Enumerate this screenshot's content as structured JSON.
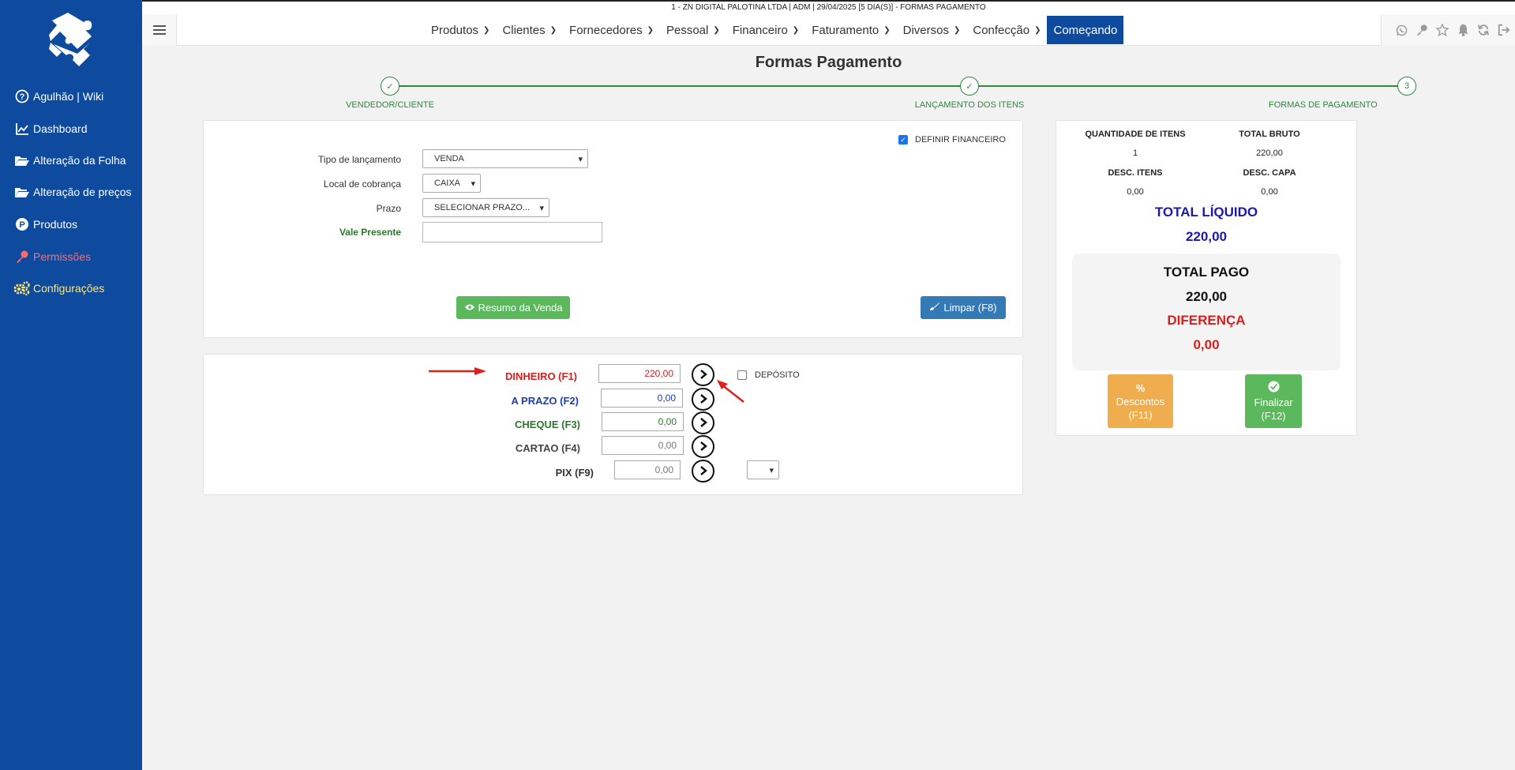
{
  "window": {
    "top_info": "1 - ZN DIGITAL PALOTINA LTDA    | ADM | 29/04/2025 [5 DIA(S)] - FORMAS PAGAMENTO"
  },
  "sidebar": {
    "items": [
      {
        "label": "Agulhão | Wiki",
        "icon": "help-circle-icon",
        "color": "#ffffff"
      },
      {
        "label": "Dashboard",
        "icon": "chart-line-icon",
        "color": "#ffffff"
      },
      {
        "label": "Alteração da Folha",
        "icon": "folder-open-icon",
        "color": "#ffffff"
      },
      {
        "label": "Alteração de preços",
        "icon": "folder-open-icon",
        "color": "#ffffff"
      },
      {
        "label": "Produtos",
        "icon": "p-circle-icon",
        "color": "#ffffff"
      },
      {
        "label": "Permissões",
        "icon": "key-icon",
        "color": "#ff6b6b"
      },
      {
        "label": "Configurações",
        "icon": "gears-icon",
        "color": "#ffe66d"
      }
    ]
  },
  "nav": {
    "items": [
      {
        "label": "Produtos"
      },
      {
        "label": "Clientes"
      },
      {
        "label": "Fornecedores"
      },
      {
        "label": "Pessoal"
      },
      {
        "label": "Financeiro"
      },
      {
        "label": "Faturamento"
      },
      {
        "label": "Diversos"
      },
      {
        "label": "Confecção"
      }
    ],
    "active_label": "Começando",
    "right_icons": [
      "whatsapp-icon",
      "key-icon",
      "star-icon",
      "bell-icon",
      "refresh-icon",
      "logout-icon"
    ]
  },
  "page": {
    "title": "Formas Pagamento"
  },
  "stepper": {
    "steps": [
      {
        "label": "VENDEDOR/CLIENTE",
        "mark": "✓"
      },
      {
        "label": "LANÇAMENTO DOS ITENS",
        "mark": "✓"
      },
      {
        "label": "FORMAS DE PAGAMENTO",
        "mark": "3"
      }
    ]
  },
  "form": {
    "definir_financeiro": {
      "label": "DEFINIR FINANCEIRO",
      "checked": true
    },
    "tipo_lancamento": {
      "label": "Tipo de lançamento",
      "value": "VENDA"
    },
    "local_cobranca": {
      "label": "Local de cobrança",
      "value": "CAIXA"
    },
    "prazo": {
      "label": "Prazo",
      "value": "SELECIONAR PRAZO..."
    },
    "vale_presente": {
      "label": "Vale Presente",
      "value": ""
    },
    "resumo_button": "Resumo da Venda",
    "limpar_button": "Limpar (F8)"
  },
  "payments": {
    "dinheiro": {
      "label": "DINHEIRO (F1)",
      "value": "220,00",
      "color": "#d62020"
    },
    "a_prazo": {
      "label": "A PRAZO (F2)",
      "value": "0,00",
      "color": "#1a3fb0"
    },
    "cheque": {
      "label": "CHEQUE (F3)",
      "value": "0,00",
      "color": "#2a7a2a"
    },
    "cartao": {
      "label": "CARTAO (F4)",
      "value": "0,00",
      "color": "#444444"
    },
    "pix": {
      "label": "PIX (F9)",
      "value": "0,00",
      "color": "#333333"
    },
    "deposito": {
      "label": "DEPÓSITO",
      "checked": false
    }
  },
  "summary": {
    "qtd_itens": {
      "label": "QUANTIDADE DE ITENS",
      "value": "1"
    },
    "total_bruto": {
      "label": "TOTAL BRUTO",
      "value": "220,00"
    },
    "desc_itens": {
      "label": "DESC. ITENS",
      "value": "0,00"
    },
    "desc_capa": {
      "label": "DESC. CAPA",
      "value": "0,00"
    },
    "total_liquido": {
      "label": "TOTAL LÍQUIDO",
      "value": "220,00"
    },
    "total_pago": {
      "label": "TOTAL PAGO",
      "value": "220,00"
    },
    "diferenca": {
      "label": "DIFERENÇA",
      "value": "0,00"
    },
    "descontos_button": {
      "label": "Descontos",
      "shortcut": "(F11)"
    },
    "finalizar_button": {
      "label": "Finalizar",
      "shortcut": "(F12)"
    }
  },
  "colors": {
    "sidebar_bg": "#0e4a9e",
    "success": "#5cb85c",
    "primary": "#337ab7",
    "warning": "#f0ad4e",
    "danger": "#d62020",
    "navy": "#1a1aa8"
  }
}
